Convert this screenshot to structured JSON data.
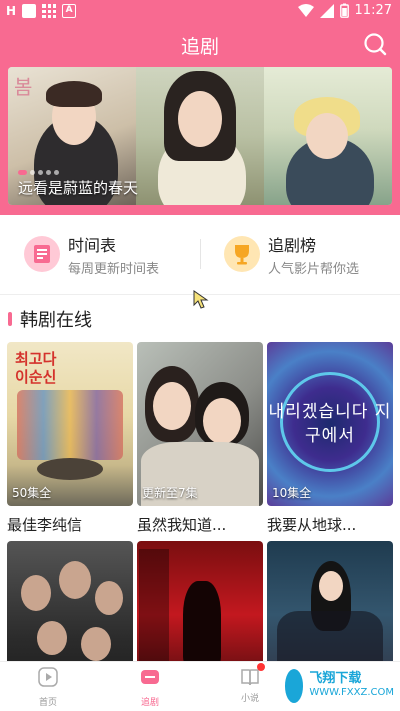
{
  "status_bar": {
    "time": "11:27"
  },
  "header": {
    "title": "追剧"
  },
  "banner": {
    "caption": "远看是蔚蓝的春天",
    "poster_text": "봄"
  },
  "quick_entries": [
    {
      "title": "时间表",
      "subtitle": "每周更新时间表"
    },
    {
      "title": "追剧榜",
      "subtitle": "人气影片帮你选"
    }
  ],
  "section": {
    "title": "韩剧在线"
  },
  "cards": [
    {
      "title": "最佳李纯信",
      "badge": "50集全",
      "poster_text": "최고다 이순신"
    },
    {
      "title": "虽然我知道...",
      "badge": "更新至7集",
      "poster_text": ""
    },
    {
      "title": "我要从地球...",
      "badge": "10集全",
      "poster_text": "내리겠습니다 지구에서"
    },
    {
      "title": "",
      "badge": "",
      "poster_text": ""
    },
    {
      "title": "",
      "badge": "",
      "poster_text": ""
    },
    {
      "title": "",
      "badge": "",
      "poster_text": ""
    }
  ],
  "nav": [
    {
      "label": "首页",
      "icon": "play-icon"
    },
    {
      "label": "追剧",
      "icon": "tv-icon",
      "active": true
    },
    {
      "label": "小说",
      "icon": "book-icon",
      "badge": true
    }
  ],
  "watermark": {
    "title": "飞翔下载",
    "url": "WWW.FXXZ.COM"
  },
  "colors": {
    "accent": "#f86a91"
  }
}
